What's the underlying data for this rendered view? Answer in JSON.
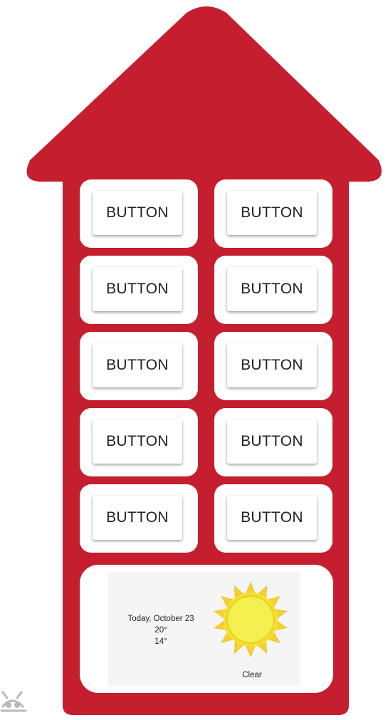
{
  "theme": {
    "house_color": "#c41e2f",
    "cell_color": "#ffffff",
    "sun_fill": "#f2ea3a",
    "sun_ray": "#f6d22b"
  },
  "grid": {
    "buttons": [
      {
        "label": "BUTTON"
      },
      {
        "label": "BUTTON"
      },
      {
        "label": "BUTTON"
      },
      {
        "label": "BUTTON"
      },
      {
        "label": "BUTTON"
      },
      {
        "label": "BUTTON"
      },
      {
        "label": "BUTTON"
      },
      {
        "label": "BUTTON"
      },
      {
        "label": "BUTTON"
      },
      {
        "label": "BUTTON"
      }
    ]
  },
  "weather": {
    "date": "Today, October 23",
    "high": "20°",
    "low": "14°",
    "condition": "Clear",
    "icon": "sun-icon"
  },
  "watermark": {
    "icon": "robot-logo-icon"
  }
}
